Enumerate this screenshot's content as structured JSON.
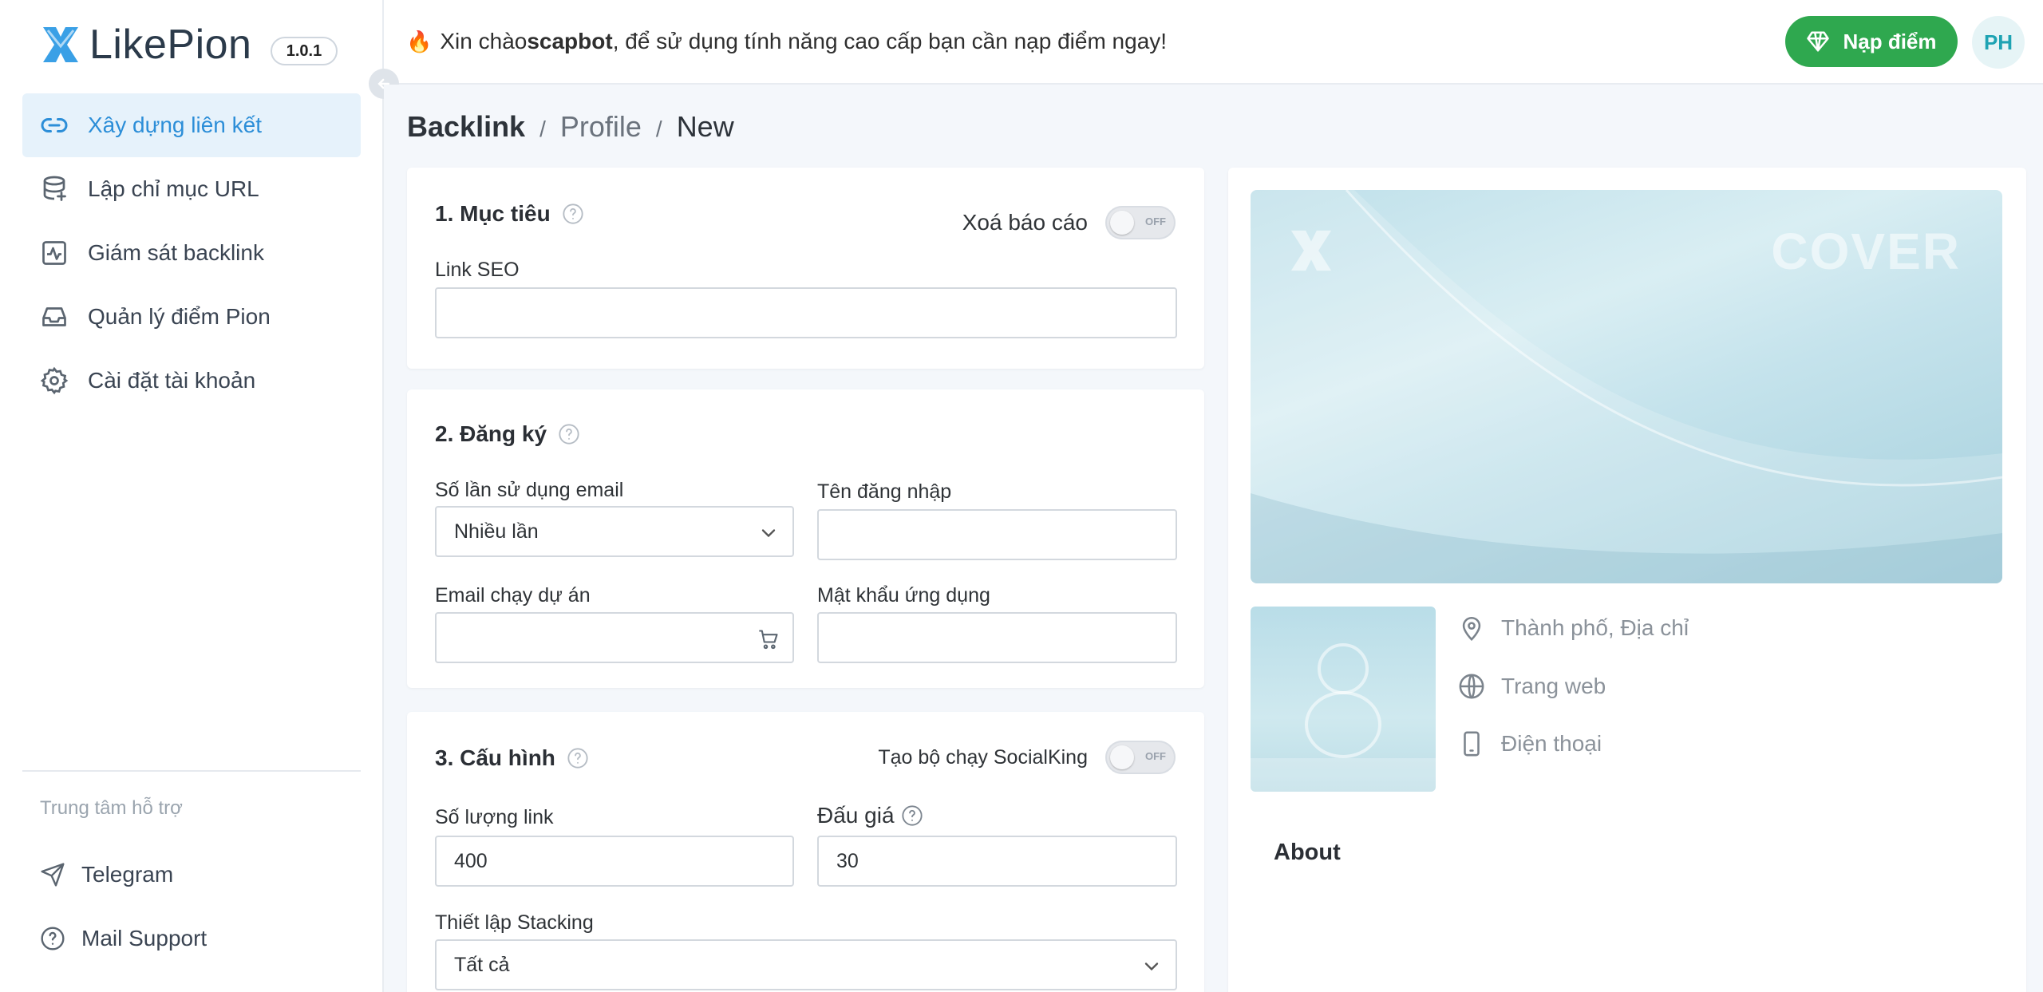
{
  "brand": {
    "name": "LikePion",
    "version": "1.0.1"
  },
  "sidebar": {
    "items": [
      {
        "label": "Xây dựng liên kết",
        "icon": "link-icon",
        "active": true
      },
      {
        "label": "Lập chỉ mục URL",
        "icon": "database-icon",
        "active": false
      },
      {
        "label": "Giám sát backlink",
        "icon": "activity-icon",
        "active": false
      },
      {
        "label": "Quản lý điểm Pion",
        "icon": "inbox-icon",
        "active": false
      },
      {
        "label": "Cài đặt tài khoản",
        "icon": "gear-icon",
        "active": false
      }
    ],
    "support_title": "Trung tâm hỗ trợ",
    "support_items": [
      {
        "label": "Telegram",
        "icon": "send-icon"
      },
      {
        "label": "Mail Support",
        "icon": "question-circle-icon"
      }
    ]
  },
  "topbar": {
    "greeting_prefix": "Xin chào ",
    "username": "scapbot",
    "greeting_suffix": ", để sử dụng tính năng cao cấp bạn cần nạp điểm ngay!",
    "topup_label": "Nạp điểm",
    "avatar_initials": "PH"
  },
  "breadcrumb": {
    "root": "Backlink",
    "middle": "Profile",
    "current": "New",
    "separator": "/"
  },
  "section1": {
    "title": "1. Mục tiêu",
    "toggle_label": "Xoá báo cáo",
    "toggle_state": "OFF",
    "link_seo_label": "Link SEO",
    "link_seo_value": ""
  },
  "section2": {
    "title": "2. Đăng ký",
    "email_usage_label": "Số lần sử dụng email",
    "email_usage_value": "Nhiều lần",
    "username_label": "Tên đăng nhập",
    "email_label": "Email chạy dự án",
    "app_password_label": "Mật khẩu ứng dụng"
  },
  "section3": {
    "title": "3. Cấu hình",
    "toggle_label": "Tạo bộ chạy SocialKing",
    "toggle_state": "OFF",
    "link_count_label": "Số lượng link",
    "link_count_value": "400",
    "bid_label": "Đấu giá",
    "bid_value": "30",
    "stacking_label": "Thiết lập Stacking",
    "stacking_value": "Tất cả"
  },
  "preview": {
    "cover_text": "COVER",
    "location": "Thành phố, Địa chỉ",
    "website": "Trang web",
    "phone": "Điện thoại",
    "about": "About"
  },
  "colors": {
    "accent": "#2c8ed8",
    "success": "#2fa84f",
    "avatar": "#1ea3b3"
  }
}
